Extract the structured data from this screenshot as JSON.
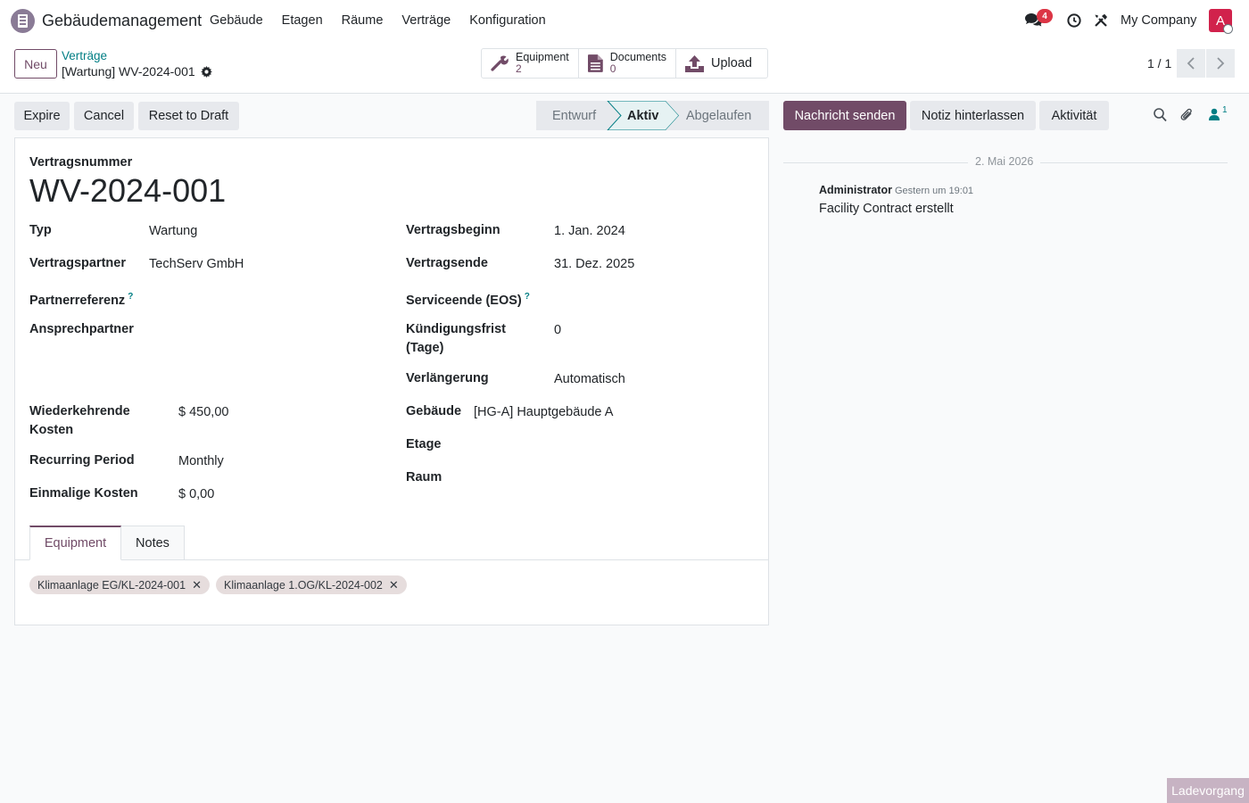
{
  "navbar": {
    "app_name": "Gebäudemanagement",
    "menu": [
      "Gebäude",
      "Etagen",
      "Räume",
      "Verträge",
      "Konfiguration"
    ],
    "messages_count": "4",
    "company": "My Company",
    "avatar_initial": "A"
  },
  "control": {
    "new_label": "Neu",
    "breadcrumb_parent": "Verträge",
    "breadcrumb_current": "[Wartung] WV-2024-001",
    "smart_buttons": [
      {
        "label": "Equipment",
        "value": "2",
        "icon": "wrench-icon"
      },
      {
        "label": "Documents",
        "value": "0",
        "icon": "document-icon"
      },
      {
        "label": "Upload",
        "icon": "upload-icon"
      }
    ],
    "pager": "1 / 1"
  },
  "statusbar": {
    "buttons": [
      "Expire",
      "Cancel",
      "Reset to Draft"
    ],
    "stages": [
      "Entwurf",
      "Aktiv",
      "Abgelaufen"
    ],
    "active_stage": "Aktiv"
  },
  "chatter": {
    "send_message": "Nachricht senden",
    "log_note": "Notiz hinterlassen",
    "activity": "Aktivität",
    "followers_count": "1",
    "date": "2. Mai 2026",
    "author": "Administrator",
    "time": "Gestern um 19:01",
    "body": "Facility Contract erstellt"
  },
  "form": {
    "number_label": "Vertragsnummer",
    "number_value": "WV-2024-001",
    "left": [
      {
        "label": "Typ",
        "value": "Wartung"
      },
      {
        "label": "Vertragspartner",
        "value": "TechServ GmbH"
      },
      {
        "label": "Partnerreferenz",
        "value": ""
      },
      {
        "label": "Ansprechpartner",
        "value": ""
      }
    ],
    "left2": [
      {
        "label": "Wiederkehrende Kosten",
        "value": "$ 450,00"
      },
      {
        "label": "Recurring Period",
        "value": "Monthly"
      },
      {
        "label": "Einmalige Kosten",
        "value": "$ 0,00"
      }
    ],
    "right": [
      {
        "label": "Vertragsbeginn",
        "value": "1. Jan. 2024"
      },
      {
        "label": "Vertragsende",
        "value": "31. Dez. 2025"
      },
      {
        "label": "Serviceende (EOS)",
        "value": ""
      },
      {
        "label": "Kündigungsfrist (Tage)",
        "value": "0"
      },
      {
        "label": "Verlängerung",
        "value": "Automatisch"
      }
    ],
    "right2": [
      {
        "label": "Gebäude",
        "value": "[HG-A] Hauptgebäude A"
      },
      {
        "label": "Etage",
        "value": ""
      },
      {
        "label": "Raum",
        "value": ""
      }
    ],
    "help_mark": "?",
    "tabs": [
      "Equipment",
      "Notes"
    ],
    "active_tab": "Equipment",
    "equipment_tags": [
      "Klimaanlage EG/KL-2024-001",
      "Klimaanlage 1.OG/KL-2024-002"
    ]
  },
  "loading": "Ladevorgang",
  "colors": {
    "primary": "#714b67",
    "link": "#017e84",
    "badge": "#dc3545",
    "avatar": "#d1224c",
    "tag": "#e6dddd"
  }
}
